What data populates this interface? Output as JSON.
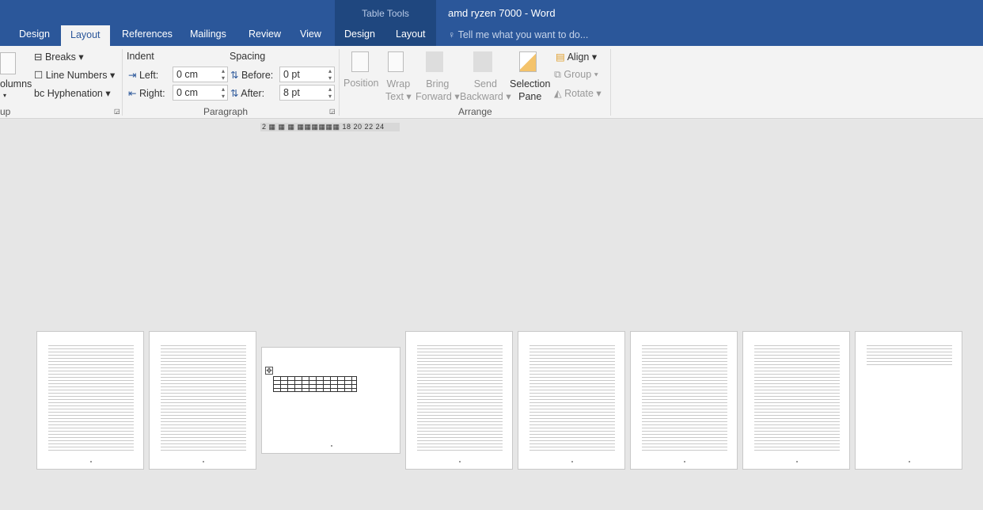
{
  "titlebar": {
    "context_group": "Table Tools",
    "title": "amd ryzen 7000 - Word"
  },
  "tabs": [
    {
      "label": "Design"
    },
    {
      "label": "Layout",
      "active": true
    },
    {
      "label": "References"
    },
    {
      "label": "Mailings"
    },
    {
      "label": "Review"
    },
    {
      "label": "View"
    }
  ],
  "context_tabs": [
    {
      "label": "Design"
    },
    {
      "label": "Layout"
    }
  ],
  "tellme": {
    "placeholder": "Tell me what you want to do..."
  },
  "ribbon": {
    "page_setup": {
      "columns": "olumns",
      "group": "up",
      "breaks": "Breaks",
      "line_numbers": "Line Numbers",
      "hyphenation": "Hyphenation"
    },
    "paragraph": {
      "group": "Paragraph",
      "indent": "Indent",
      "spacing": "Spacing",
      "left_label": "Left:",
      "left_value": "0 cm",
      "right_label": "Right:",
      "right_value": "0 cm",
      "before_label": "Before:",
      "before_value": "0 pt",
      "after_label": "After:",
      "after_value": "8 pt"
    },
    "arrange": {
      "group": "Arrange",
      "position": "Position",
      "wrap1": "Wrap",
      "wrap2": "Text",
      "bring1": "Bring",
      "bring2": "Forward",
      "send1": "Send",
      "send2": "Backward",
      "sel1": "Selection",
      "sel2": "Pane",
      "align": "Align",
      "group_btn": "Group",
      "rotate": "Rotate"
    }
  },
  "ruler": {
    "labels": "2 ▦ ▦ ▦ ▦▦▦▦▦▦ 18 20 22 24"
  },
  "accent": "#2b579a"
}
